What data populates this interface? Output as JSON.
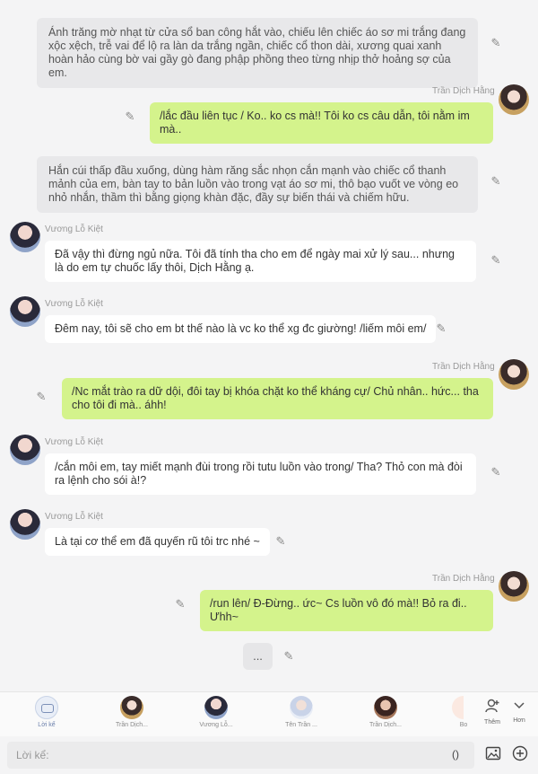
{
  "messages": [
    {
      "type": "narration",
      "text": "Ánh trăng mờ nhạt từ cửa sổ ban công hắt vào, chiếu lên chiếc áo sơ mi trắng đang xộc xệch, trễ vai để lộ ra làn da trắng ngần, chiếc cổ thon dài, xương quai xanh hoàn hảo cùng bờ vai gầy gò đang phập phồng theo từng nhịp thở hoảng sợ của em."
    },
    {
      "type": "user",
      "name": "Trần Dịch Hằng",
      "text": "/lắc đầu liên tục / Ko.. ko cs mà!! Tôi ko cs câu dẫn, tôi nằm im mà.."
    },
    {
      "type": "narration",
      "text": "Hắn cúi thấp đầu xuống, dùng hàm răng sắc nhọn cắn mạnh vào chiếc cổ thanh mảnh của em, bàn tay to bản luồn vào trong vạt áo sơ mi, thô bạo vuốt ve vòng eo nhỏ nhắn, thầm thì bằng giọng khàn đặc, đầy sự biến thái và chiếm hữu."
    },
    {
      "type": "char",
      "name": "Vương Lỗ Kiệt",
      "text": "Đã vậy thì đừng ngủ nữa. Tôi đã tính tha cho em để ngày mai xử lý sau... nhưng là do em tự chuốc lấy thôi, Dịch Hằng ạ."
    },
    {
      "type": "char",
      "name": "Vương Lỗ Kiệt",
      "text": "Đêm nay, tôi sẽ cho em bt thế nào là vc ko thể xg đc giường! /liếm môi em/"
    },
    {
      "type": "user",
      "name": "Trần Dịch Hằng",
      "text": "/Nc mắt trào ra dữ dội, đôi tay bị khóa chặt ko thể kháng cự/ Chủ nhân.. hức... tha cho tôi đi mà.. áhh!"
    },
    {
      "type": "char",
      "name": "Vương Lỗ Kiệt",
      "text": "/cắn môi em, tay miết mạnh đùi trong rồi tutu luồn vào trong/ Tha? Thỏ con mà đòi ra lệnh cho sói à!?"
    },
    {
      "type": "char",
      "name": "Vương Lỗ Kiệt",
      "text": "Là tại cơ thể em đã quyến rũ tôi trc nhé ~"
    },
    {
      "type": "user",
      "name": "Trần Dịch Hằng",
      "text": "/run lên/ Đ-Đừng.. ức~ Cs luồn vô đó mà!! Bỏ ra đi.. Ưhh~"
    }
  ],
  "ellipsis": "...",
  "characters": [
    {
      "label": "Lời kể"
    },
    {
      "label": "Trần Dịch..."
    },
    {
      "label": "Vương Lỗ..."
    },
    {
      "label": "Tên Trần ..."
    },
    {
      "label": "Trần Dịch..."
    },
    {
      "label": "Bo"
    }
  ],
  "side_buttons": {
    "more_label": "Thêm",
    "hon_label": "Hơn"
  },
  "input": {
    "placeholder": "Lời kể:",
    "paren": "()"
  },
  "icons": {
    "edit": "pencil-icon",
    "image": "image-icon",
    "add": "plus-circle-icon",
    "person": "person-add-icon",
    "chevron": "chevron-down-icon"
  }
}
